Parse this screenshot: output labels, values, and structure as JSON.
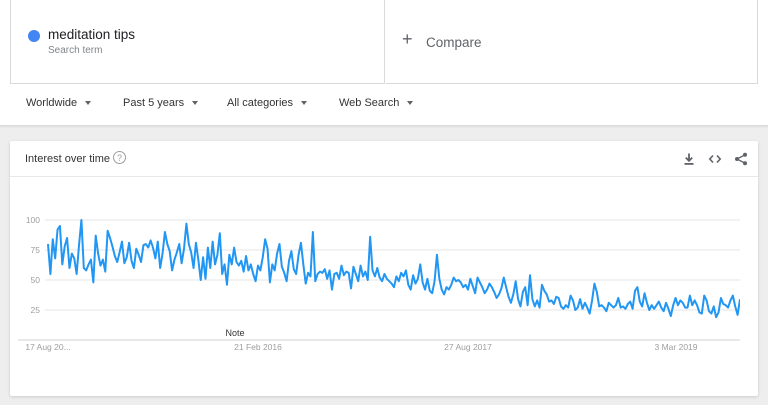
{
  "search_term": {
    "name": "meditation tips",
    "sublabel": "Search term",
    "color": "#4285f4"
  },
  "compare": {
    "label": "Compare"
  },
  "filters": [
    {
      "label": "Worldwide"
    },
    {
      "label": "Past 5 years"
    },
    {
      "label": "All categories"
    },
    {
      "label": "Web Search"
    }
  ],
  "card": {
    "title": "Interest over time"
  },
  "chart_data": {
    "type": "line",
    "title": "Interest over time",
    "xlabel": "",
    "ylabel": "",
    "ylim": [
      0,
      100
    ],
    "yticks": [
      25,
      50,
      75,
      100
    ],
    "grid": true,
    "x_tick_labels": [
      "17 Aug 20...",
      "21 Feb 2016",
      "27 Aug 2017",
      "3 Mar 2019"
    ],
    "annotations": [
      {
        "text": "Note",
        "at_date": "2016-02-21"
      }
    ],
    "series": [
      {
        "name": "meditation tips",
        "color": "#2196f3",
        "x_start": "2014-08-17",
        "x_end": "2019-08-11",
        "values": [
          80,
          55,
          84,
          68,
          92,
          95,
          63,
          78,
          85,
          60,
          72,
          68,
          55,
          79,
          100,
          60,
          58,
          63,
          67,
          48,
          87,
          72,
          62,
          67,
          57,
          91,
          85,
          78,
          70,
          65,
          73,
          82,
          64,
          69,
          81,
          66,
          60,
          76,
          71,
          65,
          79,
          80,
          77,
          83,
          77,
          68,
          82,
          60,
          72,
          90,
          80,
          74,
          58,
          67,
          73,
          80,
          64,
          76,
          97,
          80,
          73,
          60,
          81,
          67,
          50,
          69,
          51,
          77,
          60,
          82,
          63,
          71,
          89,
          55,
          63,
          46,
          71,
          63,
          77,
          65,
          62,
          66,
          57,
          70,
          58,
          63,
          55,
          49,
          62,
          58,
          69,
          84,
          76,
          48,
          63,
          58,
          72,
          80,
          61,
          56,
          49,
          66,
          74,
          59,
          55,
          71,
          81,
          63,
          47,
          56,
          53,
          90,
          49,
          55,
          57,
          56,
          59,
          51,
          58,
          42,
          55,
          56,
          51,
          62,
          54,
          57,
          56,
          43,
          61,
          55,
          49,
          62,
          53,
          57,
          50,
          86,
          58,
          53,
          60,
          52,
          49,
          55,
          51,
          49,
          47,
          44,
          53,
          49,
          56,
          53,
          58,
          46,
          42,
          54,
          47,
          51,
          63,
          48,
          42,
          51,
          41,
          39,
          49,
          71,
          51,
          42,
          38,
          44,
          42,
          46,
          52,
          49,
          50,
          48,
          44,
          46,
          42,
          51,
          45,
          39,
          52,
          48,
          44,
          39,
          42,
          47,
          44,
          40,
          35,
          38,
          43,
          52,
          44,
          36,
          31,
          38,
          49,
          34,
          28,
          40,
          44,
          29,
          54,
          34,
          28,
          33,
          27,
          46,
          41,
          38,
          32,
          33,
          30,
          36,
          35,
          28,
          26,
          29,
          27,
          37,
          33,
          25,
          27,
          34,
          26,
          31,
          27,
          22,
          33,
          47,
          40,
          28,
          29,
          27,
          24,
          31,
          29,
          27,
          29,
          35,
          27,
          28,
          26,
          30,
          32,
          26,
          41,
          44,
          32,
          28,
          39,
          31,
          25,
          29,
          26,
          29,
          32,
          27,
          24,
          31,
          26,
          20,
          29,
          35,
          29,
          33,
          31,
          27,
          27,
          37,
          29,
          33,
          29,
          23,
          22,
          37,
          33,
          24,
          22,
          28,
          19,
          23,
          35,
          30,
          29,
          27,
          33,
          37,
          28,
          21,
          34
        ]
      }
    ]
  }
}
